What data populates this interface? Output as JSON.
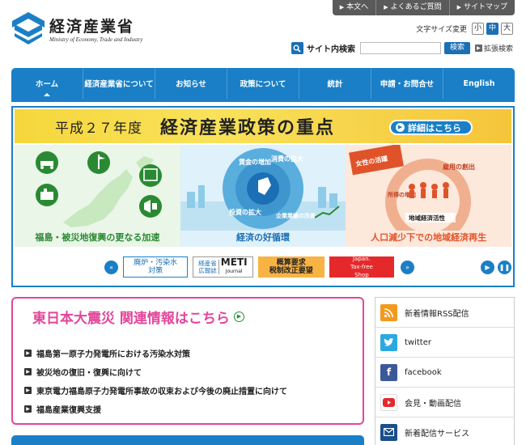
{
  "utility": {
    "items": [
      {
        "label": "本文へ"
      },
      {
        "label": "よくあるご質問"
      },
      {
        "label": "サイトマップ"
      }
    ]
  },
  "logo": {
    "name_ja": "経済産業省",
    "name_en": "Ministry of Economy, Trade and Industry"
  },
  "fontsize": {
    "label": "文字サイズ変更",
    "small": "小",
    "medium": "中",
    "large": "大"
  },
  "search": {
    "label": "サイト内検索",
    "value": "",
    "button": "検索",
    "advanced": "拡張検索"
  },
  "nav": {
    "items": [
      {
        "label": "ホーム"
      },
      {
        "label": "経済産業省について"
      },
      {
        "label": "お知らせ"
      },
      {
        "label": "政策について"
      },
      {
        "label": "統計"
      },
      {
        "label": "申請・お問合せ"
      },
      {
        "label": "English"
      }
    ]
  },
  "hero": {
    "year": "平成２７年度",
    "title": "経済産業政策の重点",
    "details": "詳細はこちら",
    "panels": [
      {
        "caption": "福島・被災地復興の更なる加速"
      },
      {
        "caption": "経済の好循環"
      },
      {
        "caption": "人口減少下での地域経済再生"
      }
    ],
    "panel_labels": {
      "wage": "賃金の増加",
      "consumption": "消費の拡大",
      "investment": "投資の拡大",
      "profit": "企業業績の改善",
      "jobs": "雇用の創出",
      "income": "所得の増加",
      "local": "地域経済活性",
      "women": "女性の活躍"
    },
    "strip": {
      "osen_line1": "廃炉・汚染水",
      "osen_line2": "対策",
      "meti_left1": "経産省",
      "meti_left2": "広報誌",
      "meti_right": "METI",
      "meti_sub": "Journal",
      "gaisan_line1": "概算要求",
      "gaisan_line2": "税制改正要望",
      "japan_line1": "Japan.",
      "japan_line2": "Tax-free",
      "japan_line3": "Shop"
    }
  },
  "quake": {
    "title": "東日本大震災 関連情報はこちら",
    "links": [
      {
        "label": "福島第一原子力発電所における汚染水対策"
      },
      {
        "label": "被災地の復旧・復興に向けて"
      },
      {
        "label": "東京電力福島原子力発電所事故の収束および今後の廃止措置に向けて"
      },
      {
        "label": "福島産業復興支援"
      }
    ]
  },
  "sidebar": {
    "items": [
      {
        "label": "新着情報RSS配信",
        "icon": "rss-icon"
      },
      {
        "label": "twitter",
        "icon": "twitter-icon"
      },
      {
        "label": "facebook",
        "icon": "facebook-icon"
      },
      {
        "label": "会見・動画配信",
        "icon": "youtube-icon"
      },
      {
        "label": "新着配信サービス",
        "icon": "mail-icon"
      }
    ]
  },
  "colors": {
    "primary": "#1a7fc6",
    "accent_pink": "#e3469a",
    "banner_yellow": "#f6d63c",
    "green": "#2a8a34",
    "orange": "#e0532a"
  }
}
